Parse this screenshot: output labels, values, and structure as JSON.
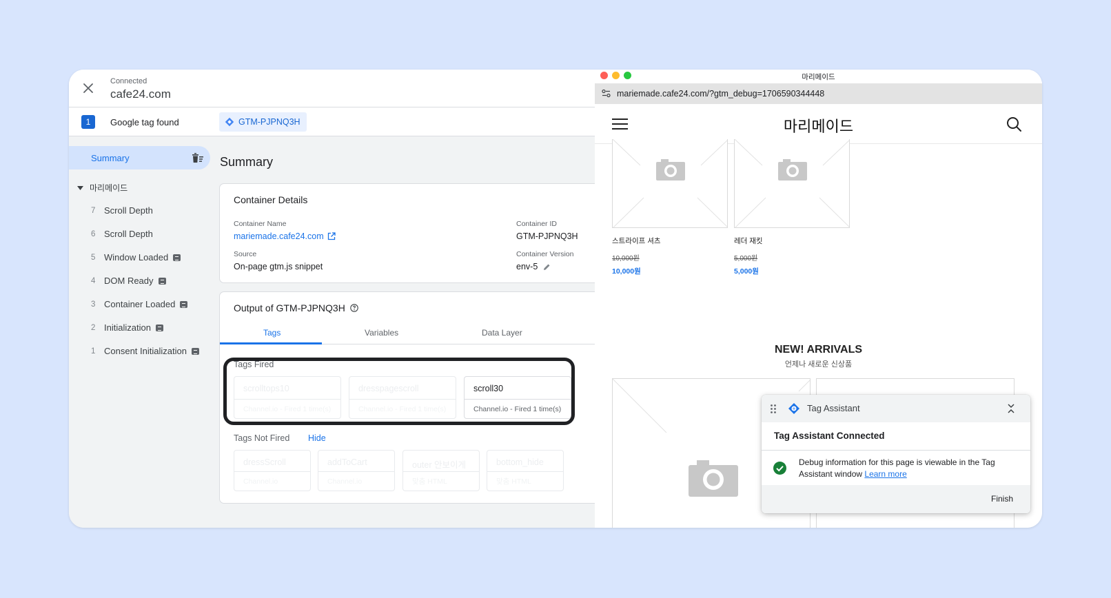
{
  "gtm": {
    "header": {
      "status": "Connected",
      "domain": "cafe24.com"
    },
    "subbar": {
      "count": "1",
      "found_label": "Google tag found",
      "container_chip": "GTM-PJPNQ3H"
    },
    "sidebar": {
      "summary_label": "Summary",
      "group_label": "마리메이드",
      "items": [
        {
          "num": "7",
          "label": "Scroll Depth",
          "badge": false
        },
        {
          "num": "6",
          "label": "Scroll Depth",
          "badge": false
        },
        {
          "num": "5",
          "label": "Window Loaded",
          "badge": true
        },
        {
          "num": "4",
          "label": "DOM Ready",
          "badge": true
        },
        {
          "num": "3",
          "label": "Container Loaded",
          "badge": true
        },
        {
          "num": "2",
          "label": "Initialization",
          "badge": true
        },
        {
          "num": "1",
          "label": "Consent Initialization",
          "badge": true
        }
      ]
    },
    "main": {
      "title": "Summary",
      "details": {
        "title": "Container Details",
        "name_label": "Container Name",
        "name_value": "mariemade.cafe24.com",
        "id_label": "Container ID",
        "id_value": "GTM-PJPNQ3H",
        "source_label": "Source",
        "source_value": "On-page gtm.js snippet",
        "version_label": "Container Version",
        "version_value": "env-5"
      },
      "output": {
        "title": "Output of GTM-PJPNQ3H",
        "tabs": [
          "Tags",
          "Variables",
          "Data Layer"
        ],
        "active_tab": "Tags",
        "fired_label": "Tags Fired",
        "fired": [
          {
            "name": "scrolltops10",
            "sub": "Channel.io - Fired 1 time(s)"
          },
          {
            "name": "dresspagescroll",
            "sub": "Channel.io - Fired 1 time(s)"
          },
          {
            "name": "scroll30",
            "sub": "Channel.io - Fired 1 time(s)"
          }
        ],
        "not_fired_label": "Tags Not Fired",
        "hide_label": "Hide",
        "not_fired": [
          {
            "name": "dressScroll",
            "sub": "Channel.io"
          },
          {
            "name": "addToCart",
            "sub": "Channel.io"
          },
          {
            "name": "outer 안보이게",
            "sub": "맞춤 HTML"
          },
          {
            "name": "bottom_hide",
            "sub": "맞춤 HTML"
          }
        ]
      }
    }
  },
  "browser": {
    "window_title": "마리메이드",
    "url": "mariemade.cafe24.com/?gtm_debug=1706590344448",
    "site_logo": "마리메이드",
    "products": [
      {
        "name": "스트라이프 셔츠",
        "old_price": "10,000원",
        "price": "10,000원"
      },
      {
        "name": "레더 재킷",
        "old_price": "5,000원",
        "price": "5,000원"
      }
    ],
    "arrivals_title": "NEW! ARRIVALS",
    "arrivals_subtitle": "언제나 새로운 신상품"
  },
  "tag_assistant": {
    "title": "Tag Assistant",
    "connected_heading": "Tag Assistant Connected",
    "message": "Debug information for this page is viewable in the Tag Assistant window",
    "learn_more": "Learn more",
    "finish_label": "Finish"
  },
  "colors": {
    "background": "#d8e5fd",
    "accent": "#1a73e8",
    "success": "#188038",
    "mac_red": "#fe5f57",
    "mac_yellow": "#febc2e",
    "mac_green": "#28c840"
  }
}
